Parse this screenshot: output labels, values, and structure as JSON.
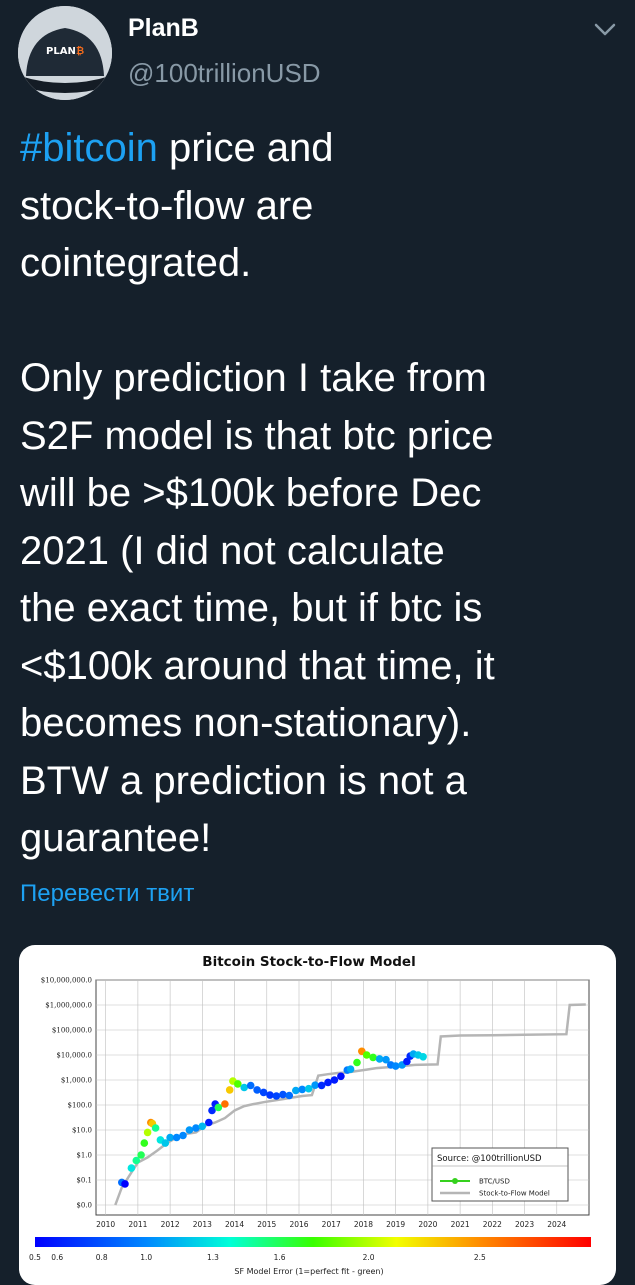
{
  "author": {
    "name": "PlanB",
    "handle": "@100trillionUSD",
    "avatar_text": "PLAN"
  },
  "header": {
    "menu_icon": "chevron-down-icon"
  },
  "tweet": {
    "hashtag": "#bitcoin",
    "text_after_hashtag": " price and\nstock-to-flow are\ncointegrated.\n\nOnly prediction I take from\nS2F model is that btc price\nwill be >$100k before Dec\n2021 (I did not calculate\nthe exact time, but if btc is\n<$100k around that time, it\nbecomes non-stationary).\nBTW a prediction is not a\nguarantee!",
    "translate_label": "Перевести твит"
  },
  "colors": {
    "background": "#15202b",
    "link": "#1da1f2",
    "secondary_text": "#8899a6"
  },
  "chart_data": {
    "type": "scatter",
    "title": "Bitcoin Stock-to-Flow Model",
    "y_scale": "log",
    "y_ticks": [
      "$10,000,000.0",
      "$1,000,000.0",
      "$100,000.0",
      "$10,000.0",
      "$1,000.0",
      "$100.0",
      "$10.0",
      "$1.0",
      "$0.1",
      "$0.0"
    ],
    "y_tick_values": [
      10000000,
      1000000,
      100000,
      10000,
      1000,
      100,
      10,
      1,
      0.1,
      0.01
    ],
    "x_ticks": [
      "2010",
      "2011",
      "2012",
      "2013",
      "2014",
      "2015",
      "2016",
      "2017",
      "2018",
      "2019",
      "2020",
      "2021",
      "2022",
      "2023",
      "2024"
    ],
    "grid": true,
    "legend_position": "bottom-right",
    "source_label": "Source: @100trillionUSD",
    "series": [
      {
        "name": "BTC/USD",
        "points": [
          [
            2010.5,
            0.08
          ],
          [
            2010.6,
            0.07
          ],
          [
            2010.8,
            0.3
          ],
          [
            2010.95,
            0.6
          ],
          [
            2011.1,
            1.0
          ],
          [
            2011.2,
            3
          ],
          [
            2011.3,
            8
          ],
          [
            2011.4,
            20
          ],
          [
            2011.45,
            18
          ],
          [
            2011.55,
            12
          ],
          [
            2011.7,
            4
          ],
          [
            2011.85,
            3
          ],
          [
            2012.0,
            5
          ],
          [
            2012.2,
            5
          ],
          [
            2012.4,
            6
          ],
          [
            2012.6,
            10
          ],
          [
            2012.8,
            12
          ],
          [
            2013.0,
            14
          ],
          [
            2013.2,
            20
          ],
          [
            2013.3,
            60
          ],
          [
            2013.4,
            110
          ],
          [
            2013.5,
            80
          ],
          [
            2013.7,
            110
          ],
          [
            2013.85,
            400
          ],
          [
            2013.95,
            900
          ],
          [
            2014.1,
            700
          ],
          [
            2014.3,
            500
          ],
          [
            2014.5,
            600
          ],
          [
            2014.7,
            400
          ],
          [
            2014.9,
            320
          ],
          [
            2015.1,
            250
          ],
          [
            2015.3,
            230
          ],
          [
            2015.5,
            260
          ],
          [
            2015.7,
            240
          ],
          [
            2015.9,
            380
          ],
          [
            2016.1,
            420
          ],
          [
            2016.3,
            450
          ],
          [
            2016.5,
            620
          ],
          [
            2016.7,
            610
          ],
          [
            2016.9,
            800
          ],
          [
            2017.1,
            1000
          ],
          [
            2017.3,
            1400
          ],
          [
            2017.5,
            2500
          ],
          [
            2017.6,
            2700
          ],
          [
            2017.8,
            5000
          ],
          [
            2017.95,
            14000
          ],
          [
            2018.1,
            10000
          ],
          [
            2018.3,
            8000
          ],
          [
            2018.5,
            7000
          ],
          [
            2018.7,
            6500
          ],
          [
            2018.85,
            4000
          ],
          [
            2019.0,
            3600
          ],
          [
            2019.2,
            4000
          ],
          [
            2019.35,
            5500
          ],
          [
            2019.45,
            9000
          ],
          [
            2019.55,
            11000
          ],
          [
            2019.7,
            10000
          ],
          [
            2019.85,
            8500
          ]
        ],
        "error_values": [
          0.9,
          0.5,
          1.3,
          1.5,
          1.6,
          1.7,
          2.0,
          2.5,
          2.3,
          1.5,
          1.3,
          1.2,
          1.1,
          1.0,
          1.0,
          1.05,
          1.0,
          1.15,
          0.6,
          0.65,
          0.6,
          1.6,
          2.6,
          2.3,
          2.0,
          1.8,
          1.2,
          0.9,
          0.85,
          0.75,
          0.7,
          0.75,
          0.8,
          0.9,
          1.1,
          1.0,
          1.2,
          1.05,
          0.65,
          0.6,
          0.6,
          0.55,
          0.95,
          1.1,
          1.7,
          2.5,
          1.8,
          1.7,
          1.1,
          1.05,
          0.95,
          1.0,
          1.05,
          0.6,
          0.65,
          1.1,
          1.2,
          1.25
        ]
      },
      {
        "name": "Stock-to-Flow Model",
        "points": [
          [
            2010.3,
            0.01
          ],
          [
            2010.5,
            0.05
          ],
          [
            2010.8,
            0.2
          ],
          [
            2011.0,
            0.5
          ],
          [
            2011.3,
            0.8
          ],
          [
            2011.6,
            1.5
          ],
          [
            2011.9,
            3
          ],
          [
            2012.2,
            5
          ],
          [
            2012.5,
            7
          ],
          [
            2012.8,
            8
          ],
          [
            2013.1,
            15
          ],
          [
            2013.4,
            20
          ],
          [
            2013.7,
            30
          ],
          [
            2014.0,
            60
          ],
          [
            2014.3,
            90
          ],
          [
            2014.6,
            110
          ],
          [
            2014.9,
            130
          ],
          [
            2015.2,
            150
          ],
          [
            2015.5,
            170
          ],
          [
            2015.8,
            200
          ],
          [
            2016.1,
            230
          ],
          [
            2016.4,
            250
          ],
          [
            2016.6,
            1500
          ],
          [
            2016.9,
            1700
          ],
          [
            2017.2,
            1900
          ],
          [
            2017.5,
            2000
          ],
          [
            2017.8,
            2300
          ],
          [
            2018.1,
            2600
          ],
          [
            2018.4,
            3000
          ],
          [
            2018.7,
            3200
          ],
          [
            2019.0,
            3400
          ],
          [
            2019.3,
            3700
          ],
          [
            2019.6,
            4000
          ],
          [
            2020.3,
            4200
          ],
          [
            2020.4,
            55000
          ],
          [
            2021.0,
            60000
          ],
          [
            2022.0,
            62000
          ],
          [
            2023.0,
            65000
          ],
          [
            2024.3,
            68000
          ],
          [
            2024.4,
            1000000
          ],
          [
            2024.9,
            1050000
          ]
        ]
      }
    ],
    "color_bar": {
      "label": "SF Model Error (1=perfect fit - green)",
      "ticks": [
        "0.5",
        "0.6",
        "0.8",
        "1.0",
        "1.3",
        "1.6",
        "2.0",
        "2.5"
      ],
      "tick_values": [
        0.5,
        0.6,
        0.8,
        1.0,
        1.3,
        1.6,
        2.0,
        2.5
      ],
      "range": [
        0.5,
        3.0
      ]
    }
  }
}
